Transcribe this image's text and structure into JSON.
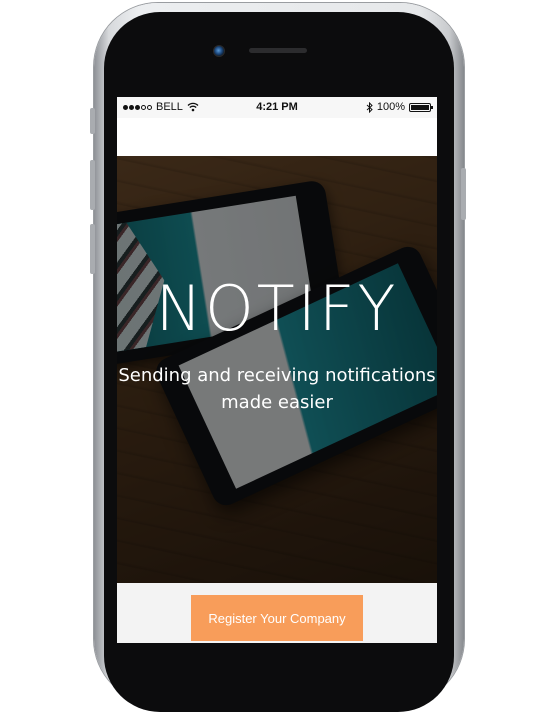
{
  "status_bar": {
    "carrier": "BELL",
    "time": "4:21 PM",
    "battery_percent": "100%",
    "signal_bars_filled": 3,
    "signal_bars_total": 5
  },
  "hero": {
    "title": "NOTIFY",
    "subtitle_line1": "Sending and receiving notifications",
    "subtitle_line2": "made easier"
  },
  "actions": {
    "register_label": "Register Your Company"
  },
  "colors": {
    "register_button": "#f89d5a",
    "hero_text": "#ffffff"
  },
  "icons": [
    "wifi-icon",
    "bluetooth-icon",
    "battery-icon",
    "signal-icon"
  ]
}
